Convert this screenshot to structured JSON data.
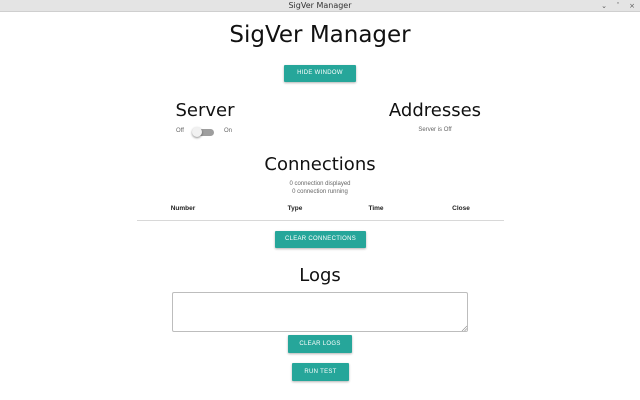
{
  "window": {
    "title": "SigVer Manager",
    "controls": [
      "minimize-icon",
      "maximize-icon",
      "close-icon"
    ]
  },
  "app": {
    "title": "SigVer Manager",
    "hide_window_label": "Hide Window",
    "accent_color": "#26a69a"
  },
  "server": {
    "heading": "Server",
    "off_label": "Off",
    "on_label": "On",
    "toggle_state": "off"
  },
  "addresses": {
    "heading": "Addresses",
    "status": "Server is Off"
  },
  "connections": {
    "heading": "Connections",
    "displayed_text": "0 connection displayed",
    "running_text": "0 connection running",
    "columns": [
      "Number",
      "Type",
      "Time",
      "Close"
    ],
    "rows": [],
    "clear_label": "Clear Connections"
  },
  "logs": {
    "heading": "Logs",
    "value": "",
    "clear_label": "Clear Logs",
    "run_test_label": "Run Test"
  }
}
